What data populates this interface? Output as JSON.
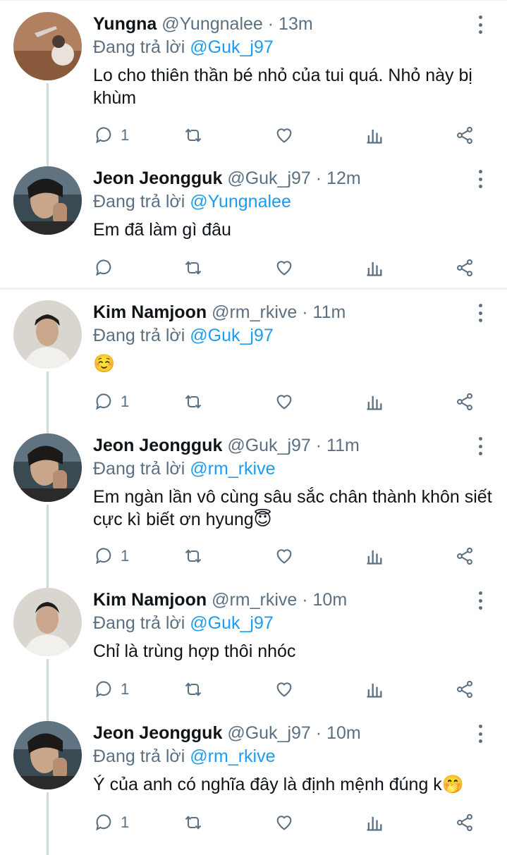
{
  "reply_prefix": "Đang trả lời",
  "tweets": [
    {
      "name": "Yungna",
      "handle": "@Yungnalee",
      "dot": "·",
      "time": "13m",
      "reply_to": "@Guk_j97",
      "text": "Lo cho thiên thần bé nhỏ của tui quá. Nhỏ này bị khùm",
      "reply_count": "1",
      "avatar": "avatar-yungna"
    },
    {
      "name": "Jeon Jeongguk",
      "handle": "@Guk_j97",
      "dot": "·",
      "time": "12m",
      "reply_to": "@Yungnalee",
      "text": "Em đã làm gì đâu",
      "reply_count": "",
      "avatar": "avatar-jeongguk"
    },
    {
      "name": "Kim Namjoon",
      "handle": "@rm_rkive",
      "dot": "·",
      "time": "11m",
      "reply_to": "@Guk_j97",
      "text": "☺️",
      "reply_count": "1",
      "avatar": "avatar-namjoon"
    },
    {
      "name": "Jeon Jeongguk",
      "handle": "@Guk_j97",
      "dot": "·",
      "time": "11m",
      "reply_to": "@rm_rkive",
      "text": "Em ngàn lần vô cùng sâu sắc chân thành khôn siết cực kì biết ơn hyung😇",
      "reply_count": "1",
      "avatar": "avatar-jeongguk"
    },
    {
      "name": "Kim Namjoon",
      "handle": "@rm_rkive",
      "dot": "·",
      "time": "10m",
      "reply_to": "@Guk_j97",
      "text": "Chỉ là trùng hợp thôi nhóc",
      "reply_count": "1",
      "avatar": "avatar-namjoon"
    },
    {
      "name": "Jeon Jeongguk",
      "handle": "@Guk_j97",
      "dot": "·",
      "time": "10m",
      "reply_to": "@rm_rkive",
      "text": "Ý của anh có nghĩa đây là định mệnh đúng k🤭",
      "reply_count": "1",
      "avatar": "avatar-jeongguk"
    }
  ],
  "icons": {
    "reply": "reply-icon",
    "retweet": "retweet-icon",
    "like": "heart-icon",
    "analytics": "analytics-icon",
    "share": "share-icon",
    "more": "more-icon"
  },
  "colors": {
    "mention": "#1d9bf0",
    "muted": "#5b7083",
    "text": "#0f1419",
    "thread": "#cfd9de"
  }
}
